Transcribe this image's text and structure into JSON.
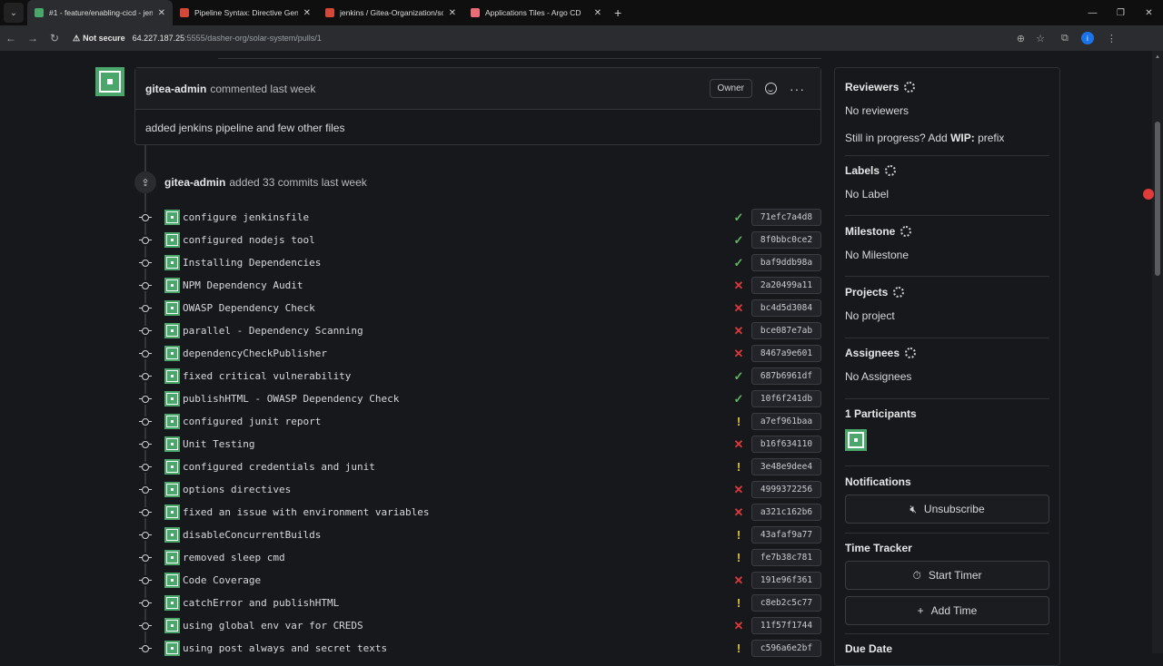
{
  "browser": {
    "tabs": [
      {
        "title": "#1 - feature/enabling-cicd - jen",
        "active": true,
        "favicon_color": "#4aa66a"
      },
      {
        "title": "Pipeline Syntax: Directive Gene",
        "active": false,
        "favicon_color": "#d24939"
      },
      {
        "title": "jenkins / Gitea-Organization/so",
        "active": false,
        "favicon_color": "#d24939"
      },
      {
        "title": "Applications Tiles - Argo CD",
        "active": false,
        "favicon_color": "#e96d76"
      }
    ],
    "security_label": "Not secure",
    "url_host": "64.227.187.25",
    "url_rest": ":5555/dasher-org/solar-system/pulls/1",
    "profile_initial": "i"
  },
  "comment": {
    "author": "gitea-admin",
    "meta": "commented last week",
    "owner_label": "Owner",
    "body": "added jenkins pipeline and few other files"
  },
  "push_event": {
    "author": "gitea-admin",
    "meta": "added 33 commits last week"
  },
  "commits": [
    {
      "message": "configure jenkinsfile",
      "status": "success",
      "sha": "71efc7a4d8"
    },
    {
      "message": "configured nodejs tool",
      "status": "success",
      "sha": "8f0bbc0ce2"
    },
    {
      "message": "Installing Dependencies",
      "status": "success",
      "sha": "baf9ddb98a"
    },
    {
      "message": "NPM Dependency Audit",
      "status": "failure",
      "sha": "2a20499a11"
    },
    {
      "message": "OWASP Dependency Check",
      "status": "failure",
      "sha": "bc4d5d3084"
    },
    {
      "message": "parallel - Dependency Scanning",
      "status": "failure",
      "sha": "bce087e7ab"
    },
    {
      "message": "dependencyCheckPublisher",
      "status": "failure",
      "sha": "8467a9e601"
    },
    {
      "message": "fixed critical vulnerability",
      "status": "success",
      "sha": "687b6961df"
    },
    {
      "message": "publishHTML - OWASP Dependency Check",
      "status": "success",
      "sha": "10f6f241db"
    },
    {
      "message": "configured junit report",
      "status": "warning",
      "sha": "a7ef961baa"
    },
    {
      "message": "Unit Testing",
      "status": "failure",
      "sha": "b16f634110"
    },
    {
      "message": "configured credentials and junit",
      "status": "warning",
      "sha": "3e48e9dee4"
    },
    {
      "message": "options directives",
      "status": "failure",
      "sha": "4999372256"
    },
    {
      "message": "fixed an issue with environment variables",
      "status": "failure",
      "sha": "a321c162b6"
    },
    {
      "message": "disableConcurrentBuilds",
      "status": "warning",
      "sha": "43afaf9a77"
    },
    {
      "message": "removed sleep cmd",
      "status": "warning",
      "sha": "fe7b38c781"
    },
    {
      "message": "Code Coverage",
      "status": "failure",
      "sha": "191e96f361"
    },
    {
      "message": "catchError and publishHTML",
      "status": "warning",
      "sha": "c8eb2c5c77"
    },
    {
      "message": "using global env var for CREDS",
      "status": "failure",
      "sha": "11f57f1744"
    },
    {
      "message": "using post always and secret texts",
      "status": "warning",
      "sha": "c596a6e2bf"
    }
  ],
  "status_glyphs": {
    "success": "✓",
    "failure": "✕",
    "warning": "!"
  },
  "sidebar": {
    "reviewers_title": "Reviewers",
    "reviewers_value": "No reviewers",
    "wip_prefix": "Still in progress? Add ",
    "wip_bold": "WIP:",
    "wip_suffix": " prefix",
    "labels_title": "Labels",
    "labels_value": "No Label",
    "milestone_title": "Milestone",
    "milestone_value": "No Milestone",
    "projects_title": "Projects",
    "projects_value": "No project",
    "assignees_title": "Assignees",
    "assignees_value": "No Assignees",
    "participants_title": "1 Participants",
    "notifications_title": "Notifications",
    "unsubscribe_label": "Unsubscribe",
    "time_tracker_title": "Time Tracker",
    "start_timer_label": "Start Timer",
    "add_time_label": "Add Time",
    "due_date_title": "Due Date"
  }
}
